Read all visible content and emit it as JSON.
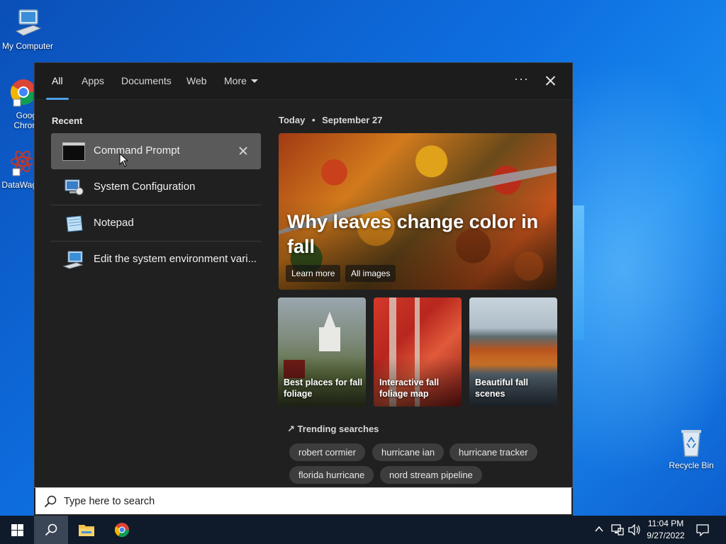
{
  "desktop": {
    "icons": [
      {
        "label": "My Computer"
      },
      {
        "label": "Goog Chron"
      },
      {
        "label": "DataWag"
      },
      {
        "label": "Recycle Bin"
      }
    ]
  },
  "search_panel": {
    "tabs": [
      {
        "label": "All"
      },
      {
        "label": "Apps"
      },
      {
        "label": "Documents"
      },
      {
        "label": "Web"
      },
      {
        "label": "More"
      }
    ],
    "more_options_label": "···",
    "recent_title": "Recent",
    "recent_items": [
      {
        "label": "Command Prompt"
      },
      {
        "label": "System Configuration"
      },
      {
        "label": "Notepad"
      },
      {
        "label": "Edit the system environment vari..."
      }
    ],
    "today_label": "Today",
    "today_separator": "•",
    "date_label": "September 27",
    "hero": {
      "headline": "Why leaves change color in fall",
      "learn_more": "Learn more",
      "all_images": "All images"
    },
    "cards": [
      {
        "caption": "Best places for fall foliage"
      },
      {
        "caption": "Interactive fall foliage map"
      },
      {
        "caption": "Beautiful fall scenes"
      }
    ],
    "trending_title": "Trending searches",
    "trending": [
      {
        "label": "robert cormier"
      },
      {
        "label": "hurricane ian"
      },
      {
        "label": "hurricane tracker"
      },
      {
        "label": "florida hurricane"
      },
      {
        "label": "nord stream pipeline"
      }
    ],
    "search_placeholder": "Type here to search"
  },
  "taskbar": {
    "clock_time": "11:04 PM",
    "clock_date": "9/27/2022"
  },
  "colors": {
    "accent": "#4ca0e8",
    "panel_bg": "#202020",
    "taskbar_bg": "#0f1a2a"
  }
}
